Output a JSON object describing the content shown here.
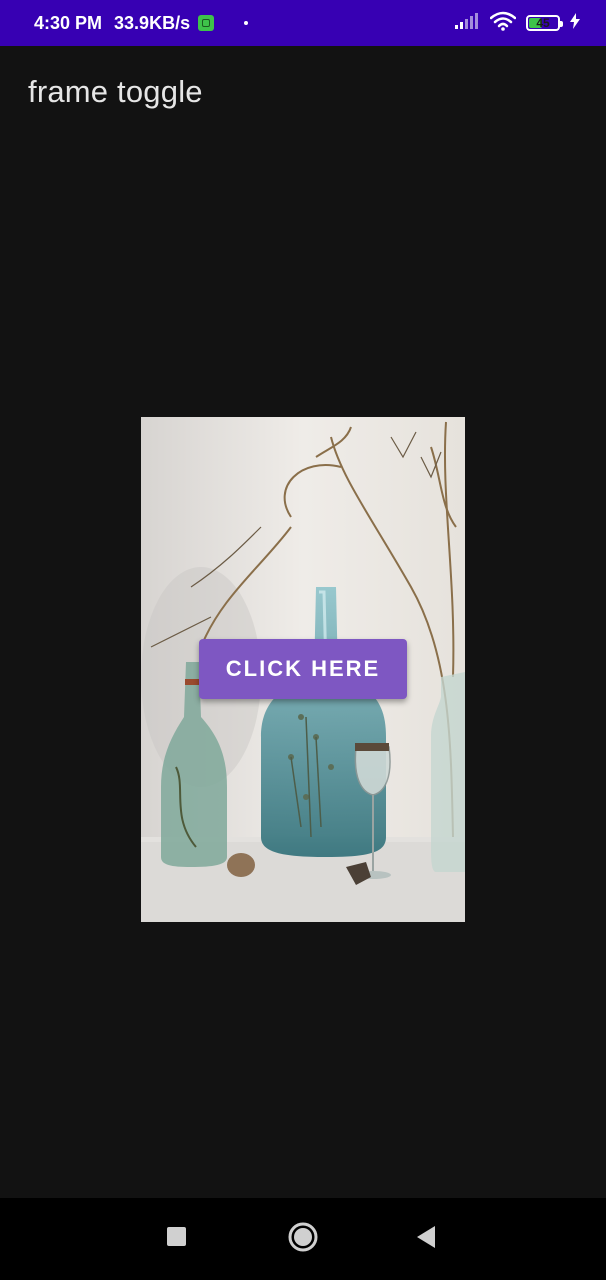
{
  "status_bar": {
    "time": "4:30 PM",
    "net_speed": "33.9KB/s",
    "battery_level": "45",
    "battery_fraction": 0.45,
    "background": "#3700b3",
    "battery_color": "#3ec34a"
  },
  "app": {
    "title": "frame toggle"
  },
  "main": {
    "button_label": "CLICK HERE",
    "button_color": "#7e57c2",
    "image_subject": "glass-bottles-dried-plants-photo"
  },
  "nav_bar": {
    "icons": [
      "recents-square-icon",
      "home-circle-icon",
      "back-triangle-icon"
    ]
  }
}
